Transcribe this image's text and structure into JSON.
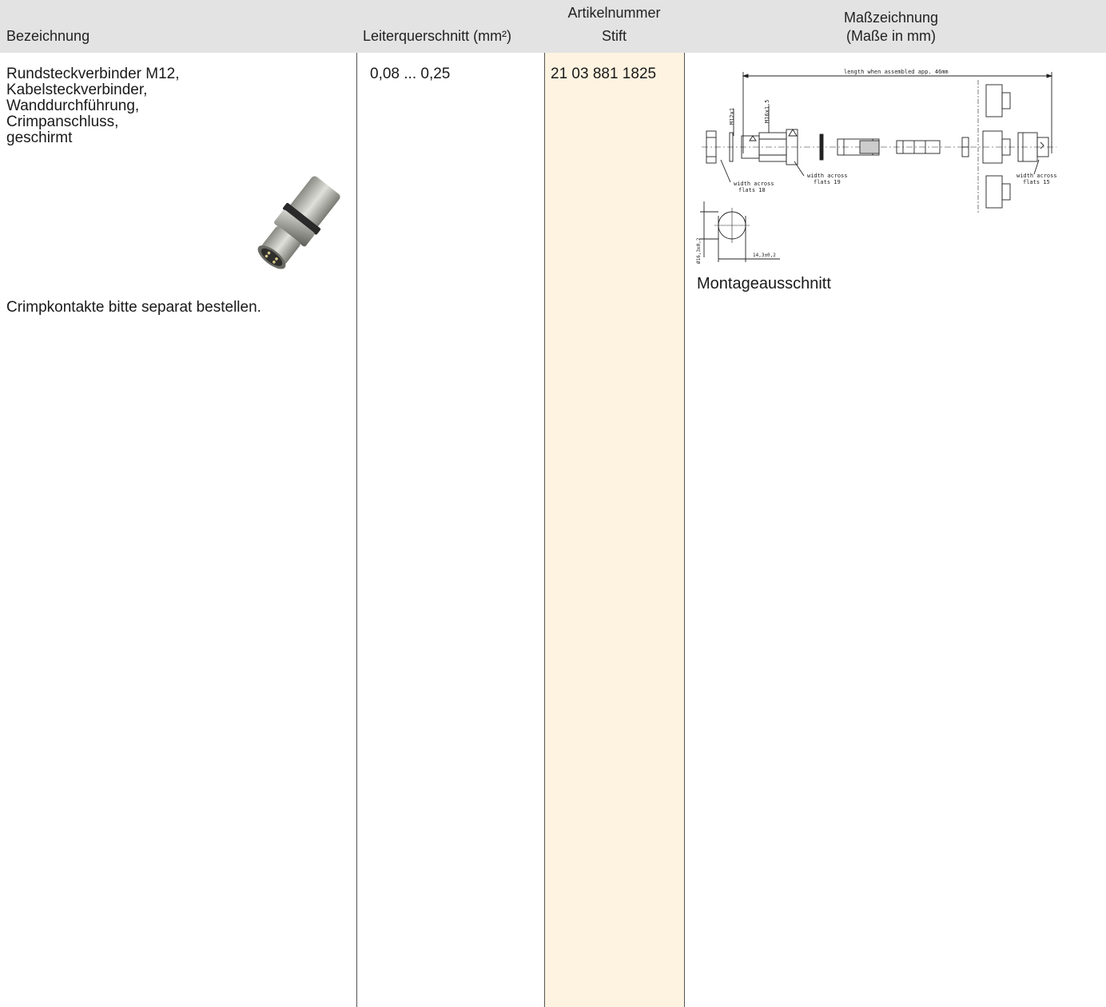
{
  "header": {
    "bezeichnung": "Bezeichnung",
    "leiterquerschnitt": "Leiterquerschnitt (mm²)",
    "artikelnummer": "Artikelnummer",
    "stift": "Stift",
    "masszeichnung": "Maßzeichnung",
    "masse_in_mm": "(Maße in mm)"
  },
  "row": {
    "description": "Rundsteckverbinder M12,\nKabelsteckverbinder,\nWanddurchführung,\nCrimpanschluss,\ngeschirmt",
    "note": "Crimpkontakte bitte separat bestellen.",
    "cross_section": "0,08 ... 0,25",
    "article_number": "21 03 881 1825",
    "drawing_caption": "Montageausschnitt"
  },
  "drawing_labels": {
    "length": "length when assembled app. 46mm",
    "m12": "M12x1",
    "m16": "M16x1,5",
    "waf18_a": "width across",
    "waf18_b": "flats 18",
    "waf19_a": "width across",
    "waf19_b": "flats 19",
    "waf15_a": "width across",
    "waf15_b": "flats 15",
    "dia": "Ø16,3±0,2",
    "width": "14,3±0,2"
  },
  "colors": {
    "header_bg": "#e3e3e3",
    "stift_column_bg": "#fdf3e0",
    "grid_line": "#555555"
  }
}
